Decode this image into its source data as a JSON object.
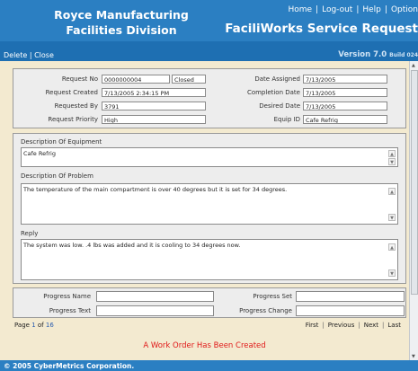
{
  "header": {
    "company_line1": "Royce Manufacturing",
    "company_line2": "Facilities Division",
    "nav": [
      "Home",
      "Log-out",
      "Help",
      "Option"
    ],
    "app_title": "FaciliWorks Service Request",
    "version": "Version 7.0",
    "build": "Build 024"
  },
  "actions": {
    "delete": "Delete",
    "close": "Close",
    "separator": "|"
  },
  "request": {
    "request_no_label": "Request No",
    "request_no": "0000000004",
    "status": "Closed",
    "request_created_label": "Request Created",
    "request_created": "7/13/2005 2:34:15 PM",
    "requested_by_label": "Requested By",
    "requested_by": "3791",
    "request_priority_label": "Request Priority",
    "request_priority": "High",
    "date_assigned_label": "Date Assigned",
    "date_assigned": "7/13/2005",
    "completion_date_label": "Completion Date",
    "completion_date": "7/13/2005",
    "desired_date_label": "Desired Date",
    "desired_date": "7/13/2005",
    "equip_id_label": "Equip ID",
    "equip_id": "Cafe Refrig"
  },
  "details": {
    "equipment_label": "Description Of Equipment",
    "equipment": "Cafe Refrig",
    "problem_label": "Description Of Problem",
    "problem": "The temperature of the main compartment is over 40 degrees but it is set for 34 degrees.",
    "reply_label": "Reply",
    "reply": "The system was low. .4 lbs was added and it is cooling to 34 degrees now."
  },
  "progress": {
    "name_label": "Progress Name",
    "name": "",
    "text_label": "Progress Text",
    "text": "",
    "set_label": "Progress Set",
    "set": "",
    "change_label": "Progress Change",
    "change": ""
  },
  "pagination": {
    "page_word": "Page",
    "current": "1",
    "of_word": "of",
    "total": "16",
    "first": "First",
    "previous": "Previous",
    "next": "Next",
    "last": "Last"
  },
  "message": "A Work Order Has Been Created",
  "footer": "© 2005 CyberMetrics Corporation.",
  "colors": {
    "header_blue": "#2b7fc2",
    "message_red": "#e01818",
    "page_bg": "#f3ead0"
  }
}
